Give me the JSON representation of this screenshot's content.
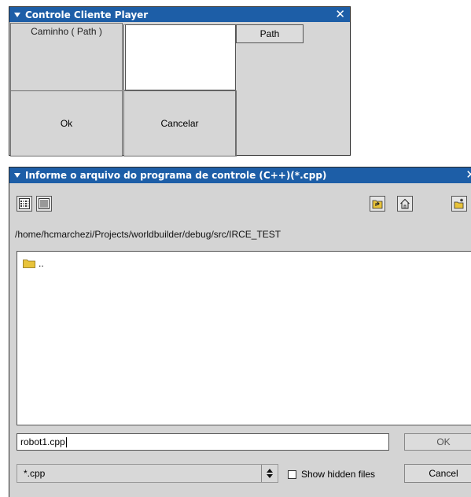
{
  "window1": {
    "title": "Controle Cliente Player",
    "close_glyph": "✕",
    "path_label": "Caminho ( Path )",
    "path_value": "",
    "path_button": "Path",
    "ok_button": "Ok",
    "cancel_button": "Cancelar"
  },
  "window2": {
    "title": "Informe o arquivo do programa de controle (C++)(*.cpp)",
    "close_glyph": "✕",
    "toolbar": {
      "icons": [
        "list-view-icon",
        "detail-view-icon",
        "parent-folder-icon",
        "home-icon",
        "new-folder-icon"
      ]
    },
    "current_path": "/home/hcmarchezi/Projects/worldbuilder/debug/src/IRCE_TEST",
    "files": [
      {
        "name": "..",
        "icon": "folder-icon"
      }
    ],
    "filename_value": "robot1.cpp",
    "ok_button": "OK",
    "filter_value": "*.cpp",
    "show_hidden_label": "Show hidden files",
    "show_hidden_checked": false,
    "cancel_button": "Cancel"
  },
  "colors": {
    "titlebar": "#1d5ea7",
    "dialog_bg": "#d6d6d6",
    "folder": "#e8c33a"
  }
}
